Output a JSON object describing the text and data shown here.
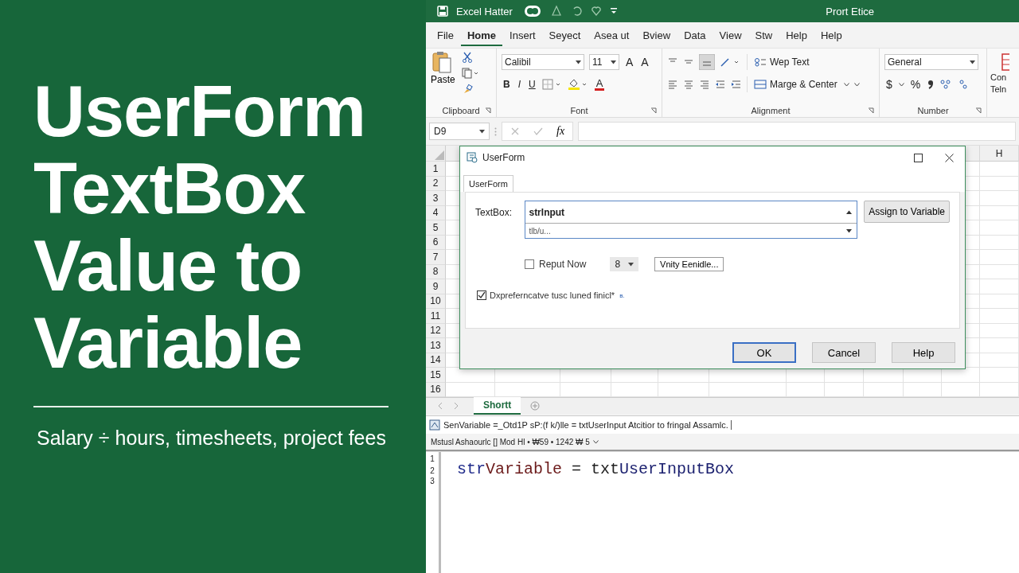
{
  "promo": {
    "title": "UserForm TextBox Value to Variable",
    "subtitle": "Salary ÷ hours, timesheets, project fees"
  },
  "title_bar": {
    "app_title": "Excel Hatter",
    "document_title": "Prort Etice"
  },
  "menu_tabs": [
    {
      "label": "File",
      "selected": false
    },
    {
      "label": "Home",
      "selected": true
    },
    {
      "label": "Insert",
      "selected": false
    },
    {
      "label": "Seyect",
      "selected": false
    },
    {
      "label": "Asea ut",
      "selected": false
    },
    {
      "label": "Bview",
      "selected": false
    },
    {
      "label": "Data",
      "selected": false
    },
    {
      "label": "View",
      "selected": false
    },
    {
      "label": "Stw",
      "selected": false
    },
    {
      "label": "Help",
      "selected": false
    },
    {
      "label": "Help",
      "selected": false
    }
  ],
  "ribbon": {
    "clipboard": {
      "paste": "Paste",
      "label": "Clipboard"
    },
    "font": {
      "name": "Calibil",
      "size": "11",
      "grow": "A",
      "shrink": "A",
      "bold": "B",
      "italic": "I",
      "underline": "U",
      "font_color_button": "A",
      "label": "Font"
    },
    "alignment": {
      "wrap": "Wep Text",
      "merge": "Marge & Center",
      "label": "Alignment"
    },
    "number": {
      "format": "General",
      "currency": "$",
      "percent": "%",
      "label": "Number"
    },
    "cut_off": [
      "Con",
      "Teln"
    ]
  },
  "formula_bar": {
    "name_box": "D9",
    "fx": "fx"
  },
  "sheet": {
    "column_headers": [
      {
        "label": "H"
      }
    ],
    "row_numbers": [
      "1",
      "2",
      "3",
      "4",
      "5",
      "6",
      "7",
      "8",
      "9",
      "10",
      "11",
      "12",
      "13",
      "14",
      "15",
      "16"
    ],
    "tabs": [
      {
        "label": "Shortt",
        "selected": true
      }
    ]
  },
  "dialog": {
    "title": "UserForm",
    "tabs": [
      {
        "label": "UserForm",
        "selected": true
      }
    ],
    "textbox_label": "TextBox:",
    "textbox_value": "strInput",
    "textbox_second_line": "tlb/u...",
    "assign_button": "Assign to Variable",
    "checkboxes": [
      {
        "label": "Reput Now",
        "checked": false
      },
      {
        "label": "Dxpreferncatve tusc luned finicl*",
        "checked": true
      }
    ],
    "checkbox_suffix": "ʙ.",
    "dropdown_value": "8",
    "option_button": "Vnity Eenidle...",
    "buttons": [
      {
        "label": "OK",
        "selected": true
      },
      {
        "label": "Cancel",
        "selected": false
      },
      {
        "label": "Help",
        "selected": false
      }
    ]
  },
  "code_editor": {
    "header": "SenVariable =_Otd1P sP:(f k/)lle = txtUserInput Atcitior to fringal Assamlc.",
    "subheader": "Mstusl Ashaourlc [] Mod Hl • ₩59 • 1242 ₩ 5",
    "line_numbers": [
      "1",
      "2",
      "3"
    ],
    "code_lines": [
      {
        "tokens": [
          {
            "text": "str",
            "kind": "keyword"
          },
          {
            "text": "Variable",
            "kind": "variable"
          },
          {
            "text": " = txt",
            "kind": "plain"
          },
          {
            "text": "UserInputBox",
            "kind": "object"
          }
        ]
      }
    ]
  }
}
